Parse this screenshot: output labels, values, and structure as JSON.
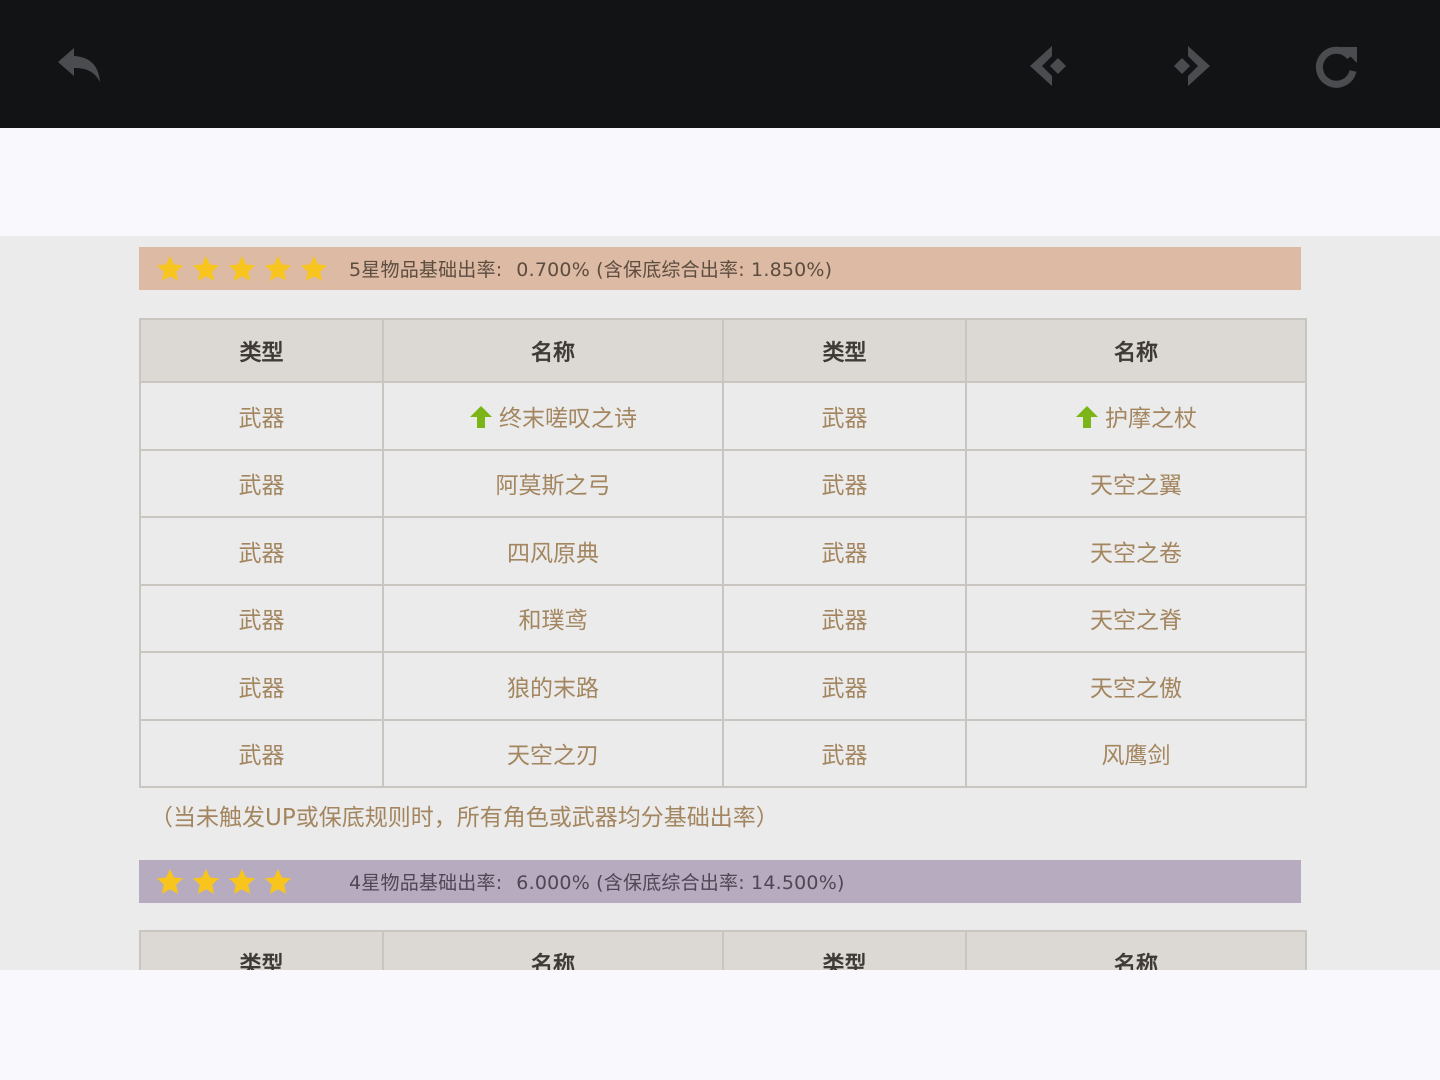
{
  "toolbar": {
    "back_icon": "back-arrow-icon",
    "prev_icon": "previous-page-icon",
    "next_icon": "next-page-icon",
    "refresh_icon": "refresh-icon",
    "icon_color": "#4b4c4f"
  },
  "five_star": {
    "star_count": 5,
    "rate_label": "5星物品基础出率:",
    "rate_value": "0.700% (含保底综合出率: 1.850%)",
    "banner_color": "#dcbaa3",
    "headers": [
      "类型",
      "名称",
      "类型",
      "名称"
    ],
    "rows": [
      {
        "type1": "武器",
        "name1": "终末嗟叹之诗",
        "up1": true,
        "type2": "武器",
        "name2": "护摩之杖",
        "up2": true
      },
      {
        "type1": "武器",
        "name1": "阿莫斯之弓",
        "up1": false,
        "type2": "武器",
        "name2": "天空之翼",
        "up2": false
      },
      {
        "type1": "武器",
        "name1": "四风原典",
        "up1": false,
        "type2": "武器",
        "name2": "天空之卷",
        "up2": false
      },
      {
        "type1": "武器",
        "name1": "和璞鸢",
        "up1": false,
        "type2": "武器",
        "name2": "天空之脊",
        "up2": false
      },
      {
        "type1": "武器",
        "name1": "狼的末路",
        "up1": false,
        "type2": "武器",
        "name2": "天空之傲",
        "up2": false
      },
      {
        "type1": "武器",
        "name1": "天空之刃",
        "up1": false,
        "type2": "武器",
        "name2": "风鹰剑",
        "up2": false
      }
    ],
    "note": "（当未触发UP或保底规则时，所有角色或武器均分基础出率）"
  },
  "four_star": {
    "star_count": 4,
    "rate_label": "4星物品基础出率:",
    "rate_value": "6.000% (含保底综合出率: 14.500%)",
    "banner_color": "#b7abbf",
    "headers": [
      "类型",
      "名称",
      "类型",
      "名称"
    ]
  },
  "colors": {
    "star": "#f7c51d",
    "up_arrow": "#7cb518",
    "cell_text": "#a3865f"
  }
}
